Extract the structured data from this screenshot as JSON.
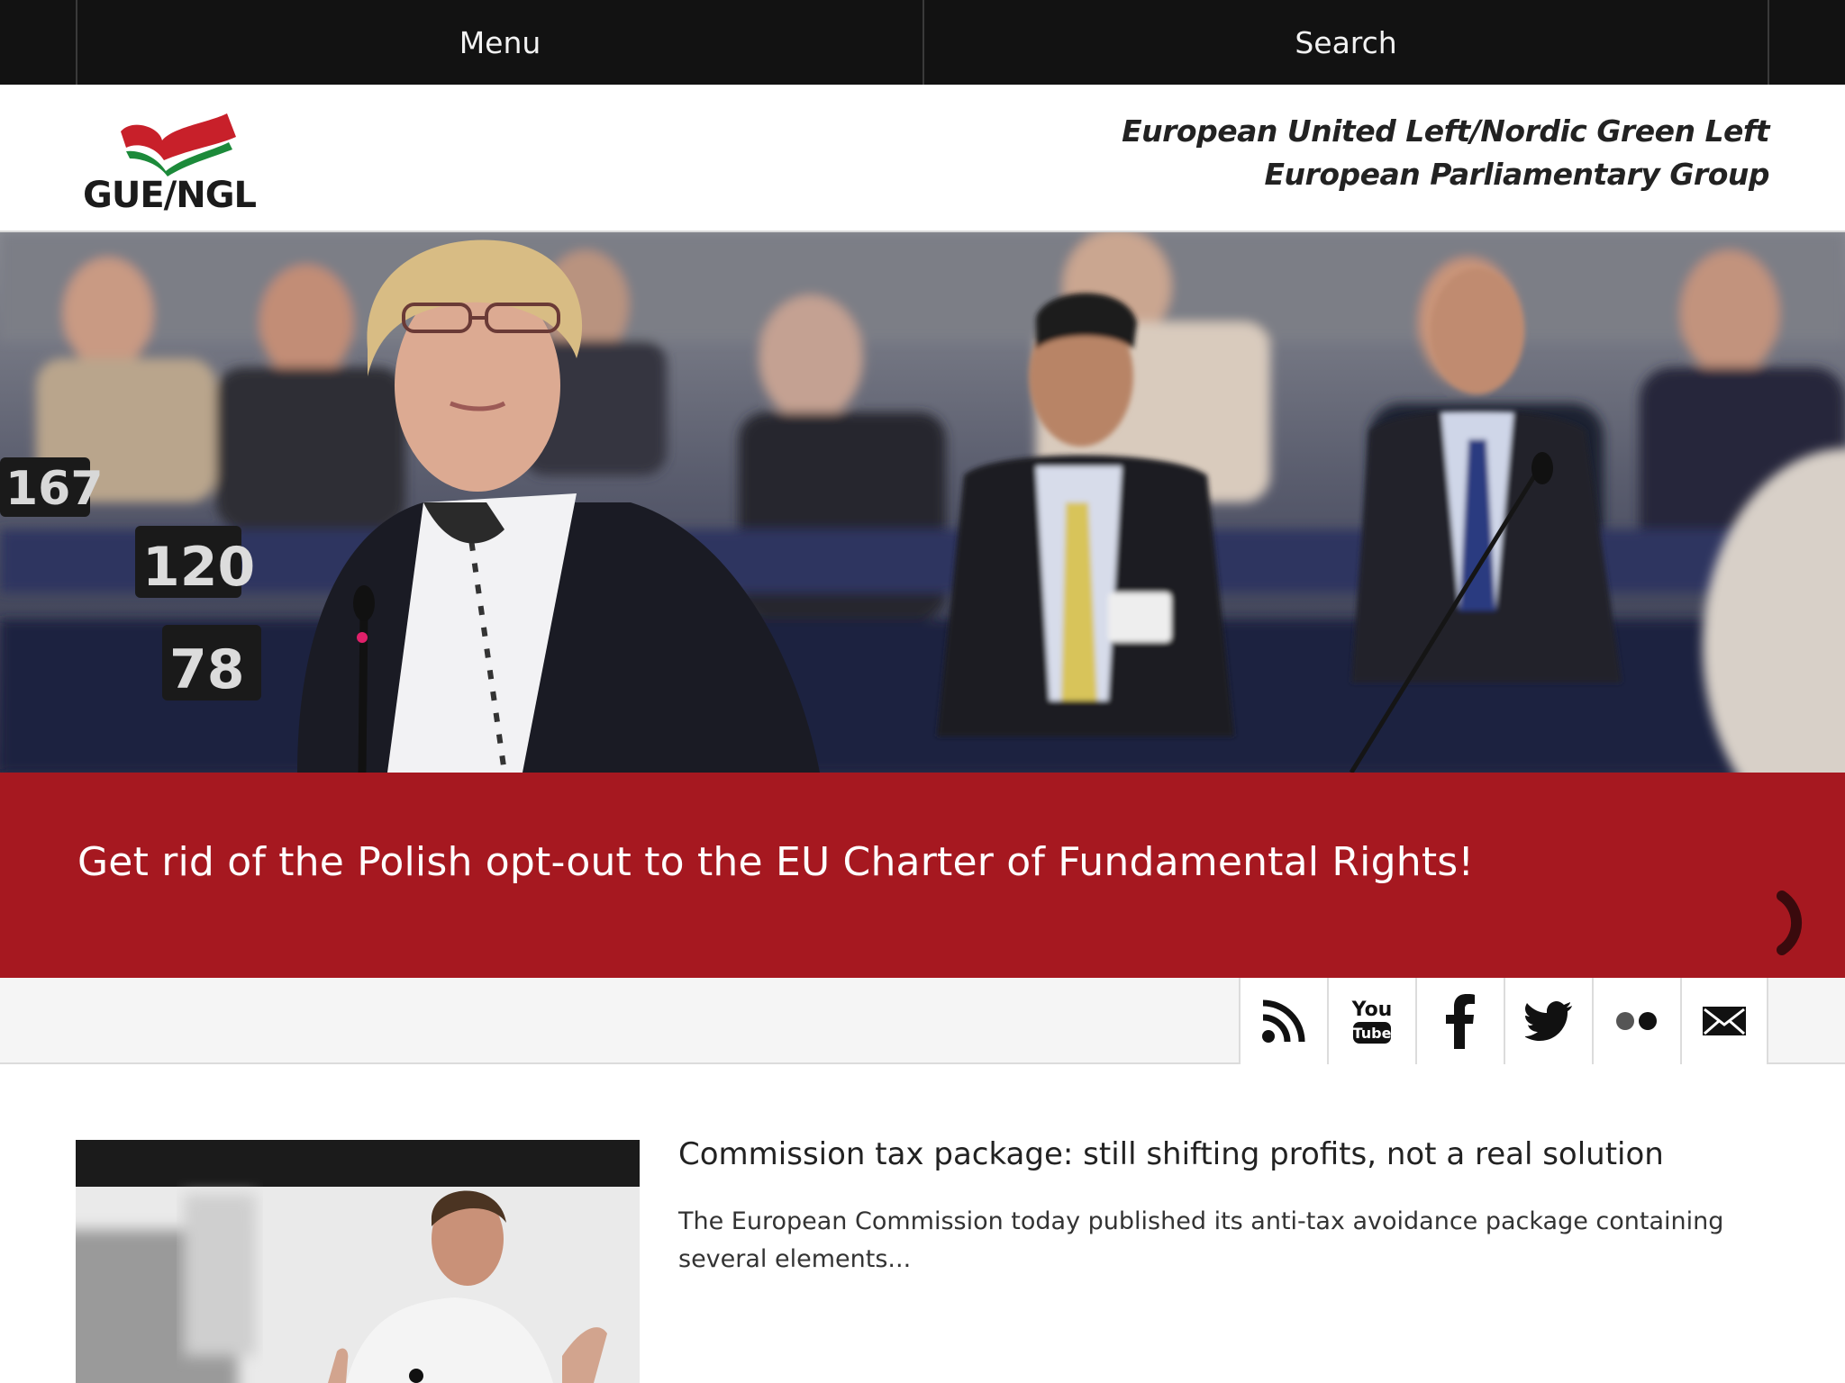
{
  "topbar": {
    "menu_label": "Menu",
    "search_label": "Search"
  },
  "header": {
    "logo_text": "GUE/NGL",
    "tagline_line1": "European United Left/Nordic Green Left",
    "tagline_line2": "European Parliamentary Group"
  },
  "hero": {
    "title": "Get rid of the Polish opt-out to the EU Charter of Fundamental Rights!",
    "seat_numbers": [
      "167",
      "120",
      "78"
    ]
  },
  "social": {
    "icons": [
      "rss-icon",
      "youtube-icon",
      "facebook-icon",
      "twitter-icon",
      "flickr-icon",
      "email-icon"
    ],
    "youtube_you": "You",
    "youtube_tube": "Tube"
  },
  "article": {
    "title": "Commission tax package: still shifting profits, not a real solution",
    "summary": "The European Commission today published its anti-tax avoidance package containing several elements..."
  },
  "colors": {
    "topbar": "#121212",
    "banner_red": "#a61820",
    "logo_red": "#c8202a",
    "logo_green": "#1c8a3a"
  }
}
